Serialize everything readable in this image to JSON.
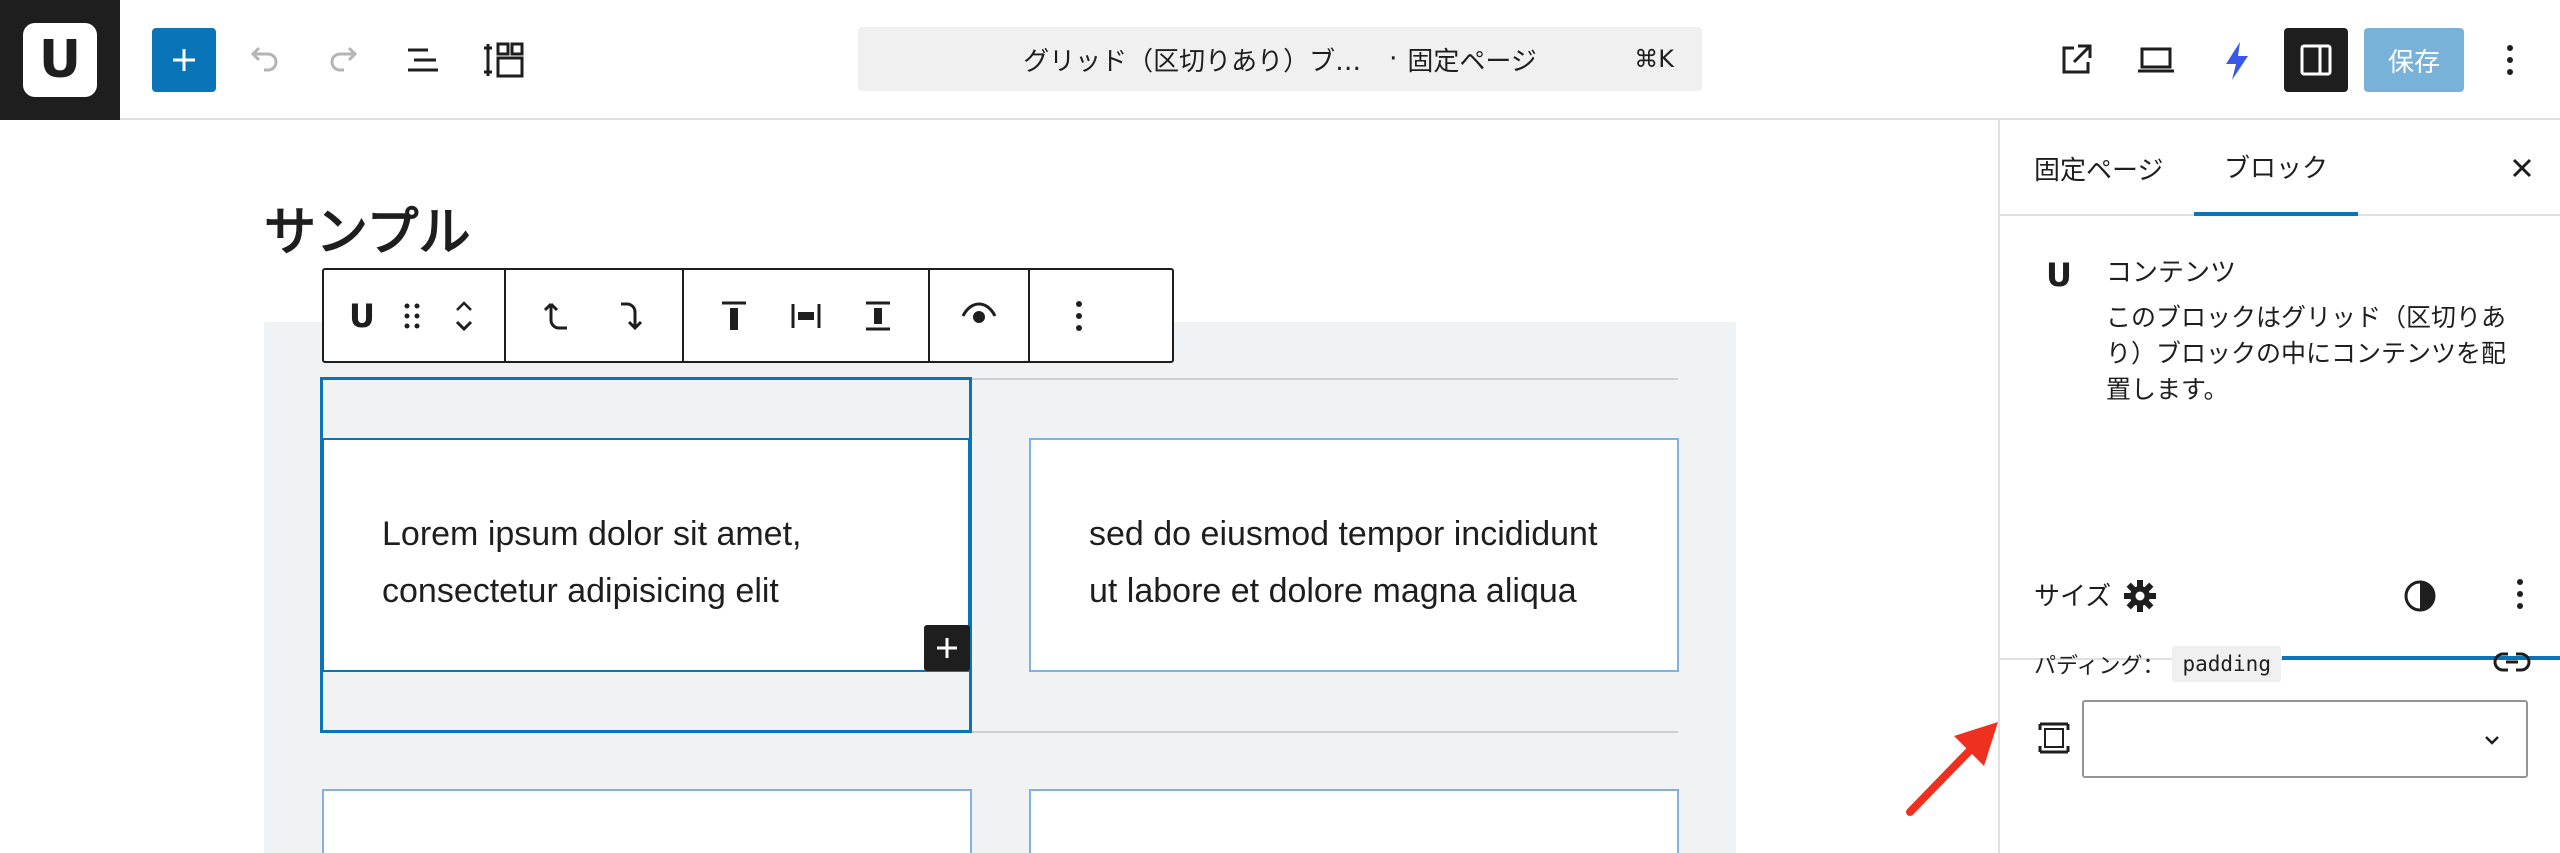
{
  "topbar": {
    "logo_letter": "U",
    "document_title": "グリッド（区切りあり）ブ…",
    "document_separator": "·",
    "document_type": "固定ページ",
    "shortcut": "⌘K",
    "save_label": "保存"
  },
  "canvas": {
    "heading": "サンプル",
    "cells": [
      {
        "text": "Lorem ipsum dolor sit amet, consectetur adipisicing elit"
      },
      {
        "text": "sed do eiusmod tempor incididunt ut labore et dolore magna aliqua"
      }
    ]
  },
  "block_toolbar": {
    "block_icon_letter": "U"
  },
  "sidebar": {
    "tabs": [
      {
        "label": "固定ページ",
        "active": false
      },
      {
        "label": "ブロック",
        "active": true
      }
    ],
    "block": {
      "icon_letter": "U",
      "name": "コンテンツ",
      "description": "このブロックはグリッド（区切りあり）ブロックの中にコンテンツを配置します。"
    },
    "size_section": {
      "title": "サイズ",
      "padding_label": "パディング：",
      "padding_code": "padding",
      "padding_value": ""
    }
  },
  "colors": {
    "accent": "#0a74b9",
    "dark": "#1e1e1e",
    "annotation_arrow": "#f0301e"
  }
}
